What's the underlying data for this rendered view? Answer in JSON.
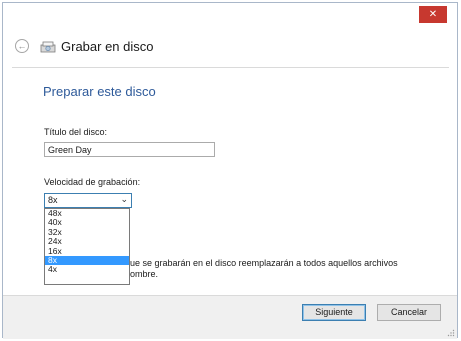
{
  "window": {
    "close_glyph": "✕"
  },
  "header": {
    "back_glyph": "←",
    "title": "Grabar en disco"
  },
  "main": {
    "heading": "Preparar este disco",
    "disc_title_label": "Título del disco:",
    "disc_title_value": "Green Day",
    "speed_label": "Velocidad de grabación:",
    "speed_selected": "8x",
    "speed_options": [
      "48x",
      "40x",
      "32x",
      "24x",
      "16x",
      "8x",
      "4x"
    ],
    "notice_line1": "ue se grabarán en el disco reemplazarán a todos aquellos archivos",
    "notice_line2": "ombre."
  },
  "footer": {
    "next_label": "Siguiente",
    "cancel_label": "Cancelar"
  },
  "colors": {
    "heading": "#2e5a9a",
    "close": "#c7382f",
    "selection": "#3399ff",
    "focus_border": "#3c7fb1"
  }
}
